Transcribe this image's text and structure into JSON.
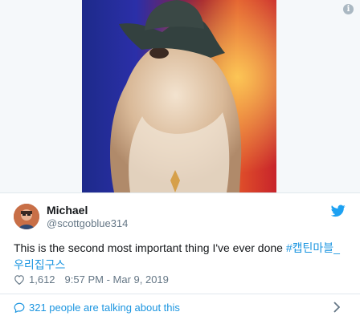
{
  "tweet": {
    "author": {
      "name": "Michael",
      "handle": "@scottgoblue314"
    },
    "text": "This is the second most important thing I've ever done ",
    "hashtag": "#캡틴마블_우리집구스",
    "likes": "1,612",
    "timestamp": "9:57 PM - Mar 9, 2019",
    "conversation": "321 people are talking about this"
  },
  "colors": {
    "link": "#1b95e0",
    "muted": "#657786",
    "twitter_blue": "#1da1f2"
  },
  "icons": [
    "info-icon",
    "twitter-bird-icon",
    "heart-icon",
    "comment-icon",
    "chevron-right-icon"
  ]
}
